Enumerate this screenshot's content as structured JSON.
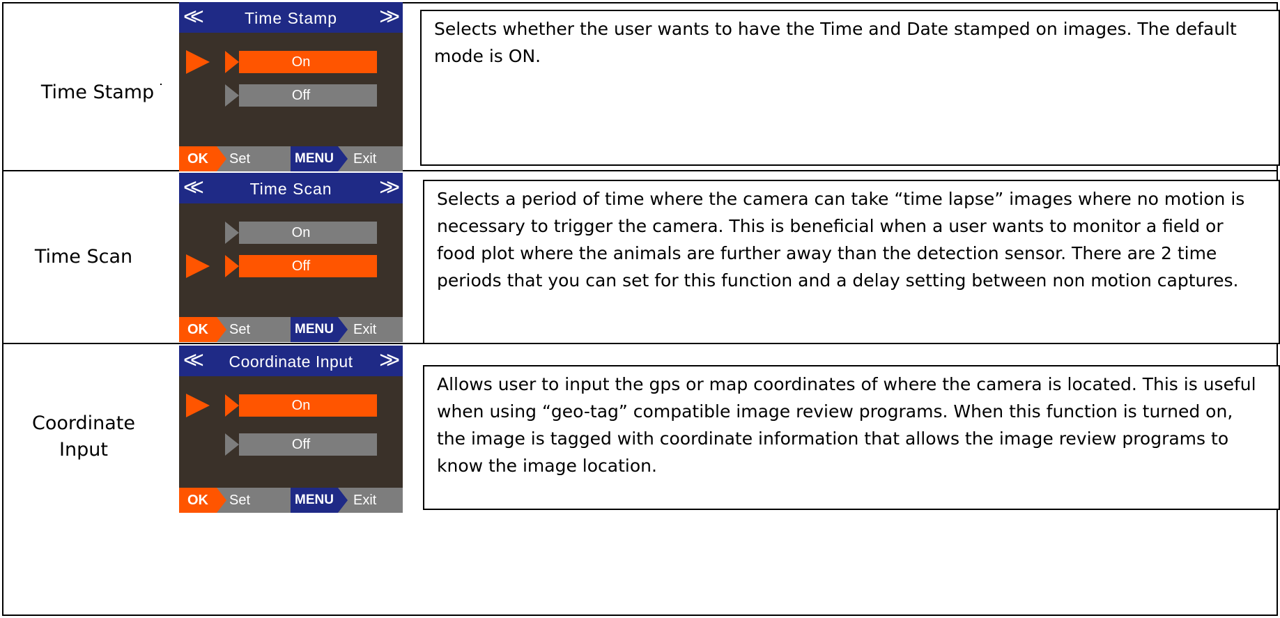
{
  "rows": [
    {
      "label": "Time Stamp",
      "screen": {
        "title": "Time Stamp",
        "options": [
          "On",
          "Off"
        ],
        "selected": "On",
        "footer": {
          "ok": "OK",
          "set": "Set",
          "menu": "MENU",
          "exit": "Exit"
        }
      },
      "description": "Selects whether the user wants to have the Time and Date stamped on images.  The default mode is ON."
    },
    {
      "label": "Time Scan",
      "screen": {
        "title": "Time Scan",
        "options": [
          "On",
          "Off"
        ],
        "selected": "Off",
        "footer": {
          "ok": "OK",
          "set": "Set",
          "menu": "MENU",
          "exit": "Exit"
        }
      },
      "description": "Selects a period of time where the camera can take “time lapse” images where no motion is necessary to trigger the camera.  This is beneficial when a user wants to monitor a field or food plot where the animals are further away than the detection sensor.  There are 2 time periods that you can set for this function and a delay setting between non motion captures."
    },
    {
      "label": "Coordinate Input",
      "screen": {
        "title": "Coordinate Input",
        "options": [
          "On",
          "Off"
        ],
        "selected": "On",
        "footer": {
          "ok": "OK",
          "set": "Set",
          "menu": "MENU",
          "exit": "Exit"
        }
      },
      "description": "Allows user to input the gps or map coordinates of where the camera is located.  This is useful when using “geo-tag” compatible image review programs.  When this function is turned on, the image is tagged with coordinate information that allows the image review programs to know the image location."
    }
  ],
  "icons": {
    "prev": "double-chevron-left-icon",
    "next": "double-chevron-right-icon",
    "cursor": "selection-arrow-icon"
  },
  "colors": {
    "header": "#1f2a86",
    "screen_bg": "#3a3129",
    "selected": "#ff5500",
    "unselected": "#7d7d7d"
  }
}
